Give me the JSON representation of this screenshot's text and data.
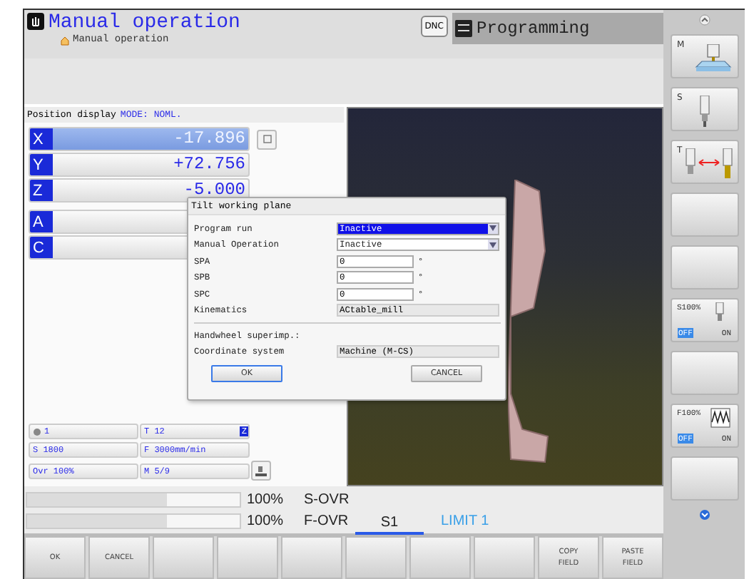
{
  "header": {
    "title": "Manual operation",
    "subtitle": "Manual operation",
    "dnc_badge": "DNC",
    "other_mode": "Programming"
  },
  "position_display": {
    "label": "Position display",
    "mode": "MODE: NOML.",
    "axes": [
      {
        "name": "X",
        "value": "-17.896",
        "selected": true
      },
      {
        "name": "Y",
        "value": "+72.756",
        "selected": false
      },
      {
        "name": "Z",
        "value": "-5.000",
        "selected": false
      },
      {
        "name": "A",
        "selected": false
      },
      {
        "name": "C",
        "selected": false
      }
    ]
  },
  "status": {
    "cells": [
      {
        "text": "1",
        "kind": "preset"
      },
      {
        "text": "T 12",
        "kind": "tool",
        "badge": "Z"
      },
      {
        "text": "S 1800",
        "kind": "plain"
      },
      {
        "text": "F 3000mm/min",
        "kind": "plain"
      },
      {
        "text": "Ovr 100%",
        "kind": "plain"
      },
      {
        "text": "M 5/9",
        "kind": "plain"
      }
    ]
  },
  "dialog": {
    "title": "Tilt working plane",
    "fields": [
      {
        "label": "Program run",
        "kind": "dropdown",
        "value": "Inactive",
        "selected": true
      },
      {
        "label": "Manual Operation",
        "kind": "dropdown",
        "value": "Inactive",
        "selected": false
      },
      {
        "label": "SPA",
        "kind": "input",
        "value": "0",
        "unit": "°"
      },
      {
        "label": "SPB",
        "kind": "input",
        "value": "0",
        "unit": "°"
      },
      {
        "label": "SPC",
        "kind": "input",
        "value": "0",
        "unit": "°"
      },
      {
        "label": "Kinematics",
        "kind": "readonly",
        "value": "ACtable_mill"
      },
      {
        "kind": "separator"
      },
      {
        "label": "Handwheel superimp.:",
        "kind": "heading"
      },
      {
        "label": "Coordinate system",
        "kind": "readonly",
        "value": "Machine (M-CS)"
      }
    ],
    "buttons": [
      {
        "label": "OK",
        "selected": true
      },
      {
        "label": "CANCEL",
        "selected": false
      }
    ]
  },
  "overrides": [
    {
      "level": 0.66,
      "percent": "100%",
      "name": "S-OVR"
    },
    {
      "level": 0.66,
      "percent": "100%",
      "name": "F-OVR"
    }
  ],
  "spindle": {
    "label": "S1",
    "active": true
  },
  "limit": "LIMIT 1",
  "side_softkeys": [
    {
      "kind": "tool",
      "label": "M"
    },
    {
      "kind": "tool",
      "label": "S"
    },
    {
      "kind": "tool",
      "label": "T"
    },
    {
      "kind": "empty"
    },
    {
      "kind": "empty"
    },
    {
      "kind": "override",
      "label": "S100%",
      "options": [
        {
          "label": "OFF",
          "selected": true
        },
        {
          "label": "ON",
          "selected": false
        }
      ]
    },
    {
      "kind": "empty"
    },
    {
      "kind": "override",
      "label": "F100%",
      "options": [
        {
          "label": "OFF",
          "selected": true
        },
        {
          "label": "ON",
          "selected": false
        }
      ]
    },
    {
      "kind": "empty"
    }
  ],
  "softkeys": [
    {
      "kind": "label",
      "lines": [
        "OK"
      ]
    },
    {
      "kind": "label",
      "lines": [
        "CANCEL"
      ]
    },
    {
      "kind": "blank"
    },
    {
      "kind": "blank"
    },
    {
      "kind": "blank"
    },
    {
      "kind": "blank"
    },
    {
      "kind": "blank"
    },
    {
      "kind": "blank"
    },
    {
      "kind": "label",
      "lines": [
        "COPY",
        "FIELD"
      ]
    },
    {
      "kind": "label",
      "lines": [
        "PASTE",
        "FIELD"
      ]
    }
  ]
}
